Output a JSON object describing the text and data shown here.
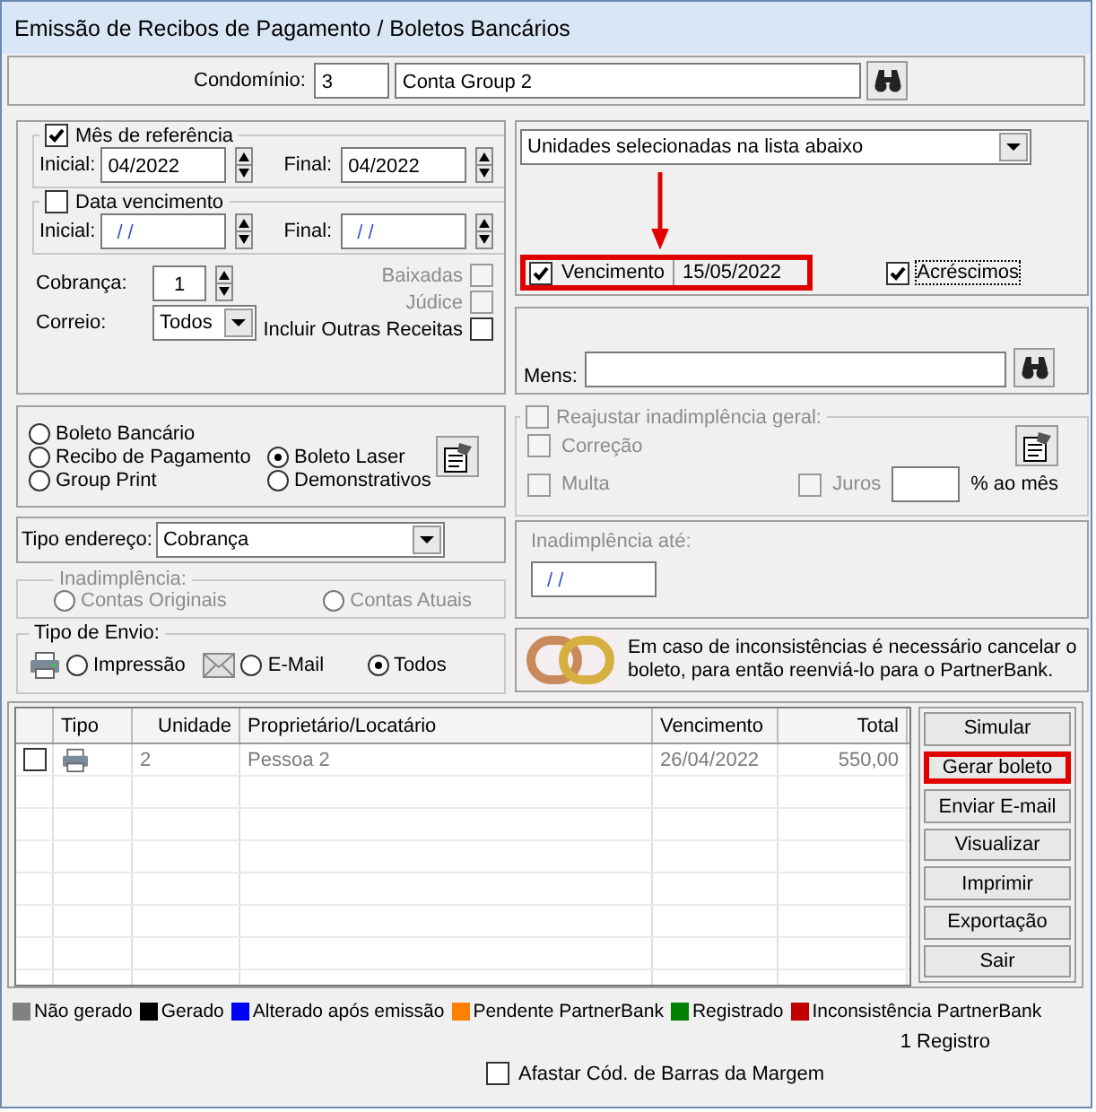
{
  "window": {
    "title": "Emissão de Recibos de Pagamento / Boletos Bancários"
  },
  "condominio": {
    "label": "Condomínio:",
    "code": "3",
    "name": "Conta Group 2"
  },
  "periodo": {
    "mes_referencia": {
      "label": "Mês de referência",
      "checked": true,
      "inicial_label": "Inicial:",
      "inicial": "04/2022",
      "final_label": "Final:",
      "final": "04/2022"
    },
    "data_vencimento": {
      "label": "Data vencimento",
      "checked": false,
      "inicial_label": "Inicial:",
      "inicial": " / /",
      "final_label": "Final:",
      "final": " / /"
    },
    "cobranca": {
      "label": "Cobrança:",
      "value": "1"
    },
    "correio": {
      "label": "Correio:",
      "value": "Todos"
    },
    "options": [
      {
        "label": "Baixadas",
        "checked": false,
        "disabled": true
      },
      {
        "label": "Júdice",
        "checked": false,
        "disabled": true
      },
      {
        "label": "Incluir Outras Receitas",
        "checked": false,
        "disabled": false
      }
    ]
  },
  "selecao": {
    "value": "Unidades selecionadas na lista abaixo",
    "vencimento": {
      "label": "Vencimento",
      "checked": true,
      "value": "15/05/2022",
      "highlighted": true
    },
    "acrescimos": {
      "label": "Acréscimos",
      "checked": true
    }
  },
  "mensagem": {
    "label": "Mens:"
  },
  "tipo_documento": [
    {
      "label": "Boleto Bancário",
      "selected": false
    },
    {
      "label": "Recibo de Pagamento",
      "selected": false
    },
    {
      "label": "Boleto Laser",
      "selected": true
    },
    {
      "label": "Group Print",
      "selected": false
    },
    {
      "label": "Demonstrativos",
      "selected": false
    }
  ],
  "reajuste": {
    "label": "Reajustar inadimplência geral:",
    "checked": false,
    "disabled": true,
    "correcao": {
      "label": "Correção",
      "checked": false
    },
    "multa": {
      "label": "Multa",
      "checked": false
    },
    "juros": {
      "label": "Juros",
      "checked": false
    },
    "suffix": "% ao mês"
  },
  "tipo_endereco": {
    "label": "Tipo endereço:",
    "value": "Cobrança"
  },
  "inadimplencia": {
    "label": "Inadimplência:",
    "disabled": true,
    "options": [
      {
        "label": "Contas Originais",
        "selected": false
      },
      {
        "label": "Contas Atuais",
        "selected": false
      }
    ]
  },
  "inadimplencia_ate": {
    "label": "Inadimplência até:",
    "value": " / /"
  },
  "tipo_envio": {
    "label": "Tipo de Envio:",
    "options": [
      {
        "label": "Impressão",
        "selected": false
      },
      {
        "label": "E-Mail",
        "selected": false
      },
      {
        "label": "Todos",
        "selected": true
      }
    ]
  },
  "aviso": {
    "text": "Em caso de inconsistências é necessário cancelar o boleto, para então reenviá-lo para o PartnerBank."
  },
  "table": {
    "columns": [
      "Tipo",
      "Unidade",
      "Proprietário/Locatário",
      "Vencimento",
      "Total"
    ],
    "rows": [
      {
        "checked": false,
        "unidade": "2",
        "proprietario": "Pessoa 2",
        "vencimento": "26/04/2022",
        "total": "550,00"
      }
    ]
  },
  "buttons": [
    {
      "label": "Simular",
      "highlighted": false
    },
    {
      "label": "Gerar boleto",
      "highlighted": true
    },
    {
      "label": "Enviar E-mail",
      "highlighted": false
    },
    {
      "label": "Visualizar",
      "highlighted": false
    },
    {
      "label": "Imprimir",
      "highlighted": false
    },
    {
      "label": "Exportação",
      "highlighted": false
    },
    {
      "label": "Sair",
      "highlighted": false
    }
  ],
  "legend": [
    {
      "label": "Não gerado",
      "color": "#808080"
    },
    {
      "label": "Gerado",
      "color": "#000000"
    },
    {
      "label": "Alterado após emissão",
      "color": "#0000ff"
    },
    {
      "label": "Pendente PartnerBank",
      "color": "#ff8000"
    },
    {
      "label": "Registrado",
      "color": "#008000"
    },
    {
      "label": "Inconsistência PartnerBank",
      "color": "#c00000"
    }
  ],
  "record_count": "1 Registro",
  "afastar": {
    "label": "Afastar Cód. de Barras da Margem",
    "checked": false
  }
}
